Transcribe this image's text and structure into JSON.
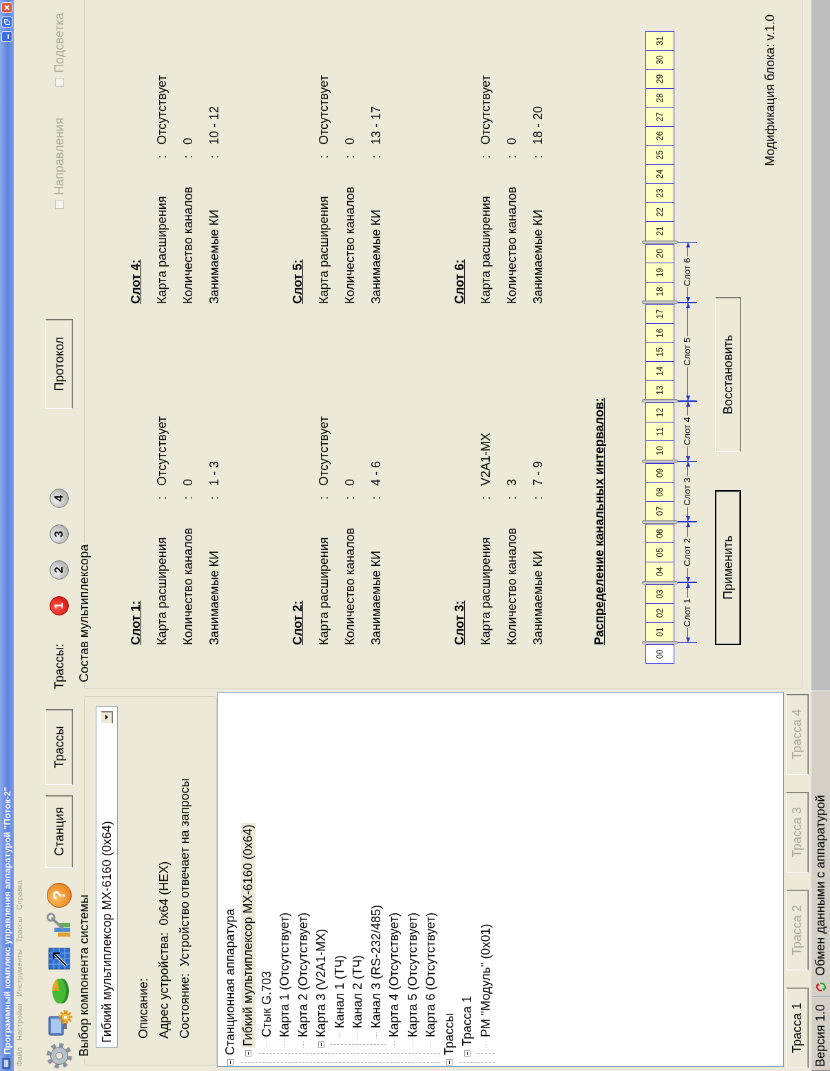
{
  "window": {
    "title": "Программный комплекс управления аппаратурой \"Поток-2\""
  },
  "menu": [
    {
      "label": "Файл",
      "disabled": true
    },
    {
      "label": "Настройки",
      "disabled": true
    },
    {
      "label": "Инструменты",
      "disabled": true
    },
    {
      "label": "Трассы",
      "disabled": true
    },
    {
      "label": "Справка",
      "disabled": true
    }
  ],
  "toolbar": {
    "help_glyph": "?",
    "buttons": [
      {
        "label": "Станция"
      },
      {
        "label": "Трассы"
      }
    ],
    "routes_label": "Трассы:",
    "routes": [
      {
        "label": "1",
        "selected": true
      },
      {
        "label": "2",
        "selected": false
      },
      {
        "label": "3",
        "selected": false
      },
      {
        "label": "4",
        "selected": false
      }
    ],
    "protocol_button": "Протокол",
    "checkboxes": [
      {
        "label": "Направления",
        "checked": false,
        "disabled": true
      },
      {
        "label": "Подсветка",
        "checked": false,
        "disabled": true
      }
    ]
  },
  "component_group": {
    "title": "Выбор компонента системы",
    "combo_value": "Гибкий мультиплексор MX-6160 (0x64)",
    "description_label": "Описание:",
    "address_label": "Адрес устройства:",
    "address_value": "0x64 (HEX)",
    "state_label": "Состояние:",
    "state_value": "Устройство отвечает на запросы"
  },
  "tree": [
    {
      "label": "Станционная аппаратура",
      "expanded": true,
      "selected": false,
      "children": [
        {
          "label": "Гибкий мультиплексор MX-6160 (0x64)",
          "expanded": true,
          "selected": true,
          "children": [
            {
              "label": "Стык G.703",
              "selected": false
            },
            {
              "label": "Карта 1 (Отсутствует)",
              "selected": false
            },
            {
              "label": "Карта 2 (Отсутствует)",
              "selected": false
            },
            {
              "label": "Карта 3 (V2A1-MX)",
              "expanded": true,
              "selected": false,
              "children": [
                {
                  "label": "Канал 1 (ТЧ)",
                  "selected": false
                },
                {
                  "label": "Канал 2 (ТЧ)",
                  "selected": false
                },
                {
                  "label": "Канал 3 (RS-232/485)",
                  "selected": false
                }
              ]
            },
            {
              "label": "Карта 4 (Отсутствует)",
              "selected": false
            },
            {
              "label": "Карта 5 (Отсутствует)",
              "selected": false
            },
            {
              "label": "Карта 6 (Отсутствует)",
              "selected": false
            }
          ]
        }
      ]
    },
    {
      "label": "Трассы",
      "expanded": true,
      "selected": false,
      "children": [
        {
          "label": "Трасса 1",
          "expanded": true,
          "selected": false,
          "children": [
            {
              "label": "РМ \"Модуль\" (0x01)",
              "selected": false
            }
          ]
        }
      ]
    }
  ],
  "route_tabs": [
    {
      "label": "Трасса 1",
      "disabled": false
    },
    {
      "label": "Трасса 2",
      "disabled": true
    },
    {
      "label": "Трасса 3",
      "disabled": true
    },
    {
      "label": "Трасса 4",
      "disabled": true
    }
  ],
  "composition": {
    "title": "Состав мультиплексора",
    "slots": [
      {
        "title": "Слот 1:",
        "rows": [
          {
            "label": "Карта расширения",
            "separator": ":",
            "value": "Отсутствует"
          },
          {
            "label": "Количество каналов",
            "separator": ":",
            "value": "0"
          },
          {
            "label": "Занимаемые КИ",
            "separator": ":",
            "value": "1 - 3"
          }
        ]
      },
      {
        "title": "Слот 2:",
        "rows": [
          {
            "label": "Карта расширения",
            "separator": ":",
            "value": "Отсутствует"
          },
          {
            "label": "Количество каналов",
            "separator": ":",
            "value": "0"
          },
          {
            "label": "Занимаемые КИ",
            "separator": ":",
            "value": "4 - 6"
          }
        ]
      },
      {
        "title": "Слот 3:",
        "rows": [
          {
            "label": "Карта расширения",
            "separator": ":",
            "value": "V2A1-MX"
          },
          {
            "label": "Количество каналов",
            "separator": ":",
            "value": "3"
          },
          {
            "label": "Занимаемые КИ",
            "separator": ":",
            "value": "7 - 9"
          }
        ]
      },
      {
        "title": "Слот 4:",
        "rows": [
          {
            "label": "Карта расширения",
            "separator": ":",
            "value": "Отсутствует"
          },
          {
            "label": "Количество каналов",
            "separator": ":",
            "value": "0"
          },
          {
            "label": "Занимаемые КИ",
            "separator": ":",
            "value": "10 - 12"
          }
        ]
      },
      {
        "title": "Слот 5:",
        "rows": [
          {
            "label": "Карта расширения",
            "separator": ":",
            "value": "Отсутствует"
          },
          {
            "label": "Количество каналов",
            "separator": ":",
            "value": "0"
          },
          {
            "label": "Занимаемые КИ",
            "separator": ":",
            "value": "13 - 17"
          }
        ]
      },
      {
        "title": "Слот 6:",
        "rows": [
          {
            "label": "Карта расширения",
            "separator": ":",
            "value": "Отсутствует"
          },
          {
            "label": "Количество каналов",
            "separator": ":",
            "value": "0"
          },
          {
            "label": "Занимаемые КИ",
            "separator": ":",
            "value": "18 - 20"
          }
        ]
      }
    ],
    "allocation_title": "Распределение канальных интервалов:",
    "intervals": [
      {
        "label": "00",
        "highlighted": false,
        "divider": false
      },
      {
        "label": "01",
        "highlighted": true,
        "divider": true
      },
      {
        "label": "02",
        "highlighted": true,
        "divider": false
      },
      {
        "label": "03",
        "highlighted": true,
        "divider": false
      },
      {
        "label": "04",
        "highlighted": true,
        "divider": true
      },
      {
        "label": "05",
        "highlighted": true,
        "divider": false
      },
      {
        "label": "06",
        "highlighted": true,
        "divider": false
      },
      {
        "label": "07",
        "highlighted": true,
        "divider": true
      },
      {
        "label": "08",
        "highlighted": true,
        "divider": false
      },
      {
        "label": "09",
        "highlighted": true,
        "divider": false
      },
      {
        "label": "10",
        "highlighted": true,
        "divider": true
      },
      {
        "label": "11",
        "highlighted": true,
        "divider": false
      },
      {
        "label": "12",
        "highlighted": true,
        "divider": false
      },
      {
        "label": "13",
        "highlighted": true,
        "divider": true
      },
      {
        "label": "14",
        "highlighted": true,
        "divider": false
      },
      {
        "label": "15",
        "highlighted": true,
        "divider": false
      },
      {
        "label": "16",
        "highlighted": true,
        "divider": false
      },
      {
        "label": "17",
        "highlighted": true,
        "divider": false
      },
      {
        "label": "18",
        "highlighted": true,
        "divider": true
      },
      {
        "label": "19",
        "highlighted": true,
        "divider": false
      },
      {
        "label": "20",
        "highlighted": true,
        "divider": false
      },
      {
        "label": "21",
        "highlighted": true,
        "divider": true
      },
      {
        "label": "22",
        "highlighted": true,
        "divider": false
      },
      {
        "label": "23",
        "highlighted": true,
        "divider": false
      },
      {
        "label": "24",
        "highlighted": true,
        "divider": false
      },
      {
        "label": "25",
        "highlighted": true,
        "divider": false
      },
      {
        "label": "26",
        "highlighted": true,
        "divider": false
      },
      {
        "label": "27",
        "highlighted": true,
        "divider": false
      },
      {
        "label": "28",
        "highlighted": true,
        "divider": false
      },
      {
        "label": "29",
        "highlighted": true,
        "divider": false
      },
      {
        "label": "30",
        "highlighted": true,
        "divider": false
      },
      {
        "label": "31",
        "highlighted": true,
        "divider": false
      }
    ],
    "slot_spans": [
      {
        "label": "Слот 1"
      },
      {
        "label": "Слот 2"
      },
      {
        "label": "Слот 3"
      },
      {
        "label": "Слот 4"
      },
      {
        "label": "Слот 5"
      },
      {
        "label": "Слот 6"
      }
    ],
    "apply_button": "Применить",
    "restore_button": "Восстановить",
    "modification": "Модификация блока: v.1.0"
  },
  "status_bar": {
    "version": "Версия 1.0",
    "exchange": "Обмен данными с аппаратурой"
  }
}
